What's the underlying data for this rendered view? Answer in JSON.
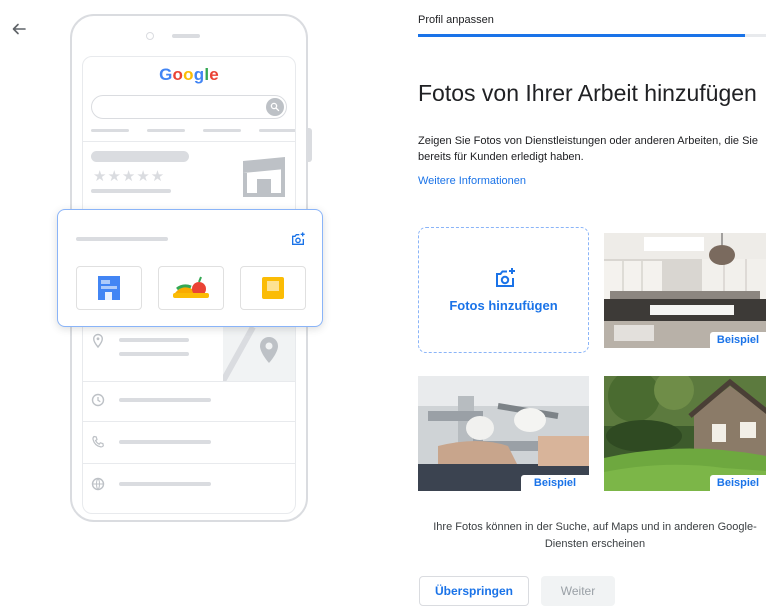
{
  "nav": {
    "back_icon": "arrow-back-icon"
  },
  "illustration": {
    "logo_letters": [
      {
        "ch": "G",
        "color": "#4285f4"
      },
      {
        "ch": "o",
        "color": "#ea4335"
      },
      {
        "ch": "o",
        "color": "#fbbc05"
      },
      {
        "ch": "g",
        "color": "#4285f4"
      },
      {
        "ch": "l",
        "color": "#34a853"
      },
      {
        "ch": "e",
        "color": "#ea4335"
      }
    ],
    "rating_stars": "★★★★★",
    "card_icon": "add-photo-icon",
    "tile_icons": [
      "storefront-icon",
      "food-icon",
      "note-icon"
    ],
    "row_icons": [
      "location-pin-icon",
      "clock-icon",
      "phone-icon",
      "globe-icon"
    ]
  },
  "progress": {
    "label": "Profil anpassen",
    "fraction": 0.94,
    "color": "#1a73e8"
  },
  "main": {
    "title": "Fotos von Ihrer Arbeit hinzufügen",
    "description": "Zeigen Sie Fotos von Dienstleistungen oder anderen Arbeiten, die Sie bereits für Kunden erledigt haben.",
    "more_info_link": "Weitere Informationen",
    "add_photos": {
      "label": "Fotos hinzufügen",
      "icon": "add-photo-icon"
    },
    "examples": [
      {
        "badge": "Beispiel",
        "subject": "kitchen"
      },
      {
        "badge": "Beispiel",
        "subject": "plumbing"
      },
      {
        "badge": "Beispiel",
        "subject": "garden-house"
      }
    ],
    "footnote": "Ihre Fotos können in der Suche, auf Maps und in anderen Google-Diensten erscheinen"
  },
  "actions": {
    "skip_label": "Überspringen",
    "next_label": "Weiter"
  },
  "colors": {
    "accent": "#1a73e8",
    "border_accent": "#8ab4f8",
    "neutral": "#dadce0"
  }
}
